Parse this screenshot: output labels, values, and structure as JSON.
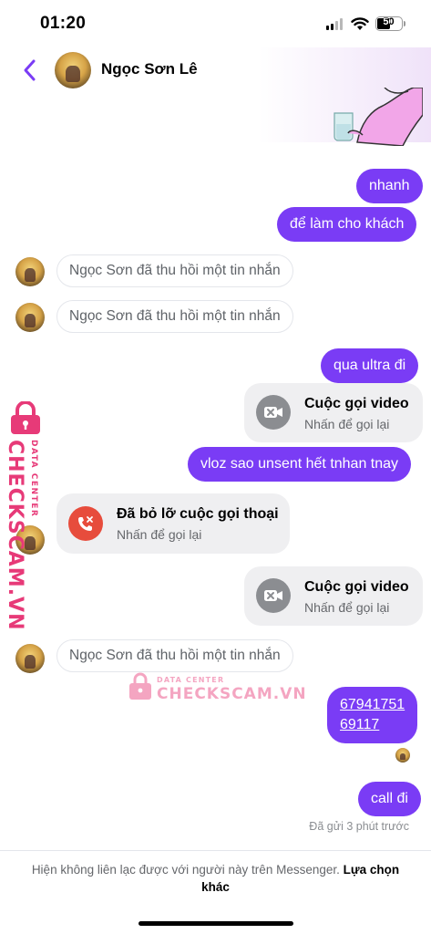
{
  "status_bar": {
    "time": "01:20",
    "battery": "50"
  },
  "header": {
    "contact_name": "Ngọc Sơn Lê"
  },
  "messages": {
    "out_1": "nhanh",
    "out_2": "để làm cho khách",
    "unsent_1": "Ngọc Sơn đã thu hồi một tin nhắn",
    "unsent_2": "Ngọc Sơn đã thu hồi một tin nhắn",
    "out_3": "qua ultra đi",
    "video_call_1": {
      "title": "Cuộc gọi video",
      "subtitle": "Nhấn để gọi lại"
    },
    "out_4": "vloz sao unsent hết tnhan tnay",
    "missed_call": {
      "title": "Đã bỏ lỡ cuộc gọi thoại",
      "subtitle": "Nhấn để gọi lại"
    },
    "video_call_2": {
      "title": "Cuộc gọi video",
      "subtitle": "Nhấn để gọi lại"
    },
    "unsent_3": "Ngọc Sơn đã thu hồi một tin nhắn",
    "out_5_line1": "67941751",
    "out_5_line2": "69117",
    "out_6": "call đi",
    "sent_status": "Đã gửi 3 phút trước"
  },
  "footer": {
    "notice": "Hiện không liên lạc được với người này trên Messenger.",
    "action": "Lựa chọn khác"
  },
  "watermark": {
    "brand": "CHECKSCAM.VN",
    "sub": "DATA CENTER"
  },
  "colors": {
    "outgoing_bubble": "#7a3cf5",
    "back_arrow": "#7a3cf5",
    "missed_call_red": "#e74c3c",
    "watermark": "#e73a78"
  }
}
